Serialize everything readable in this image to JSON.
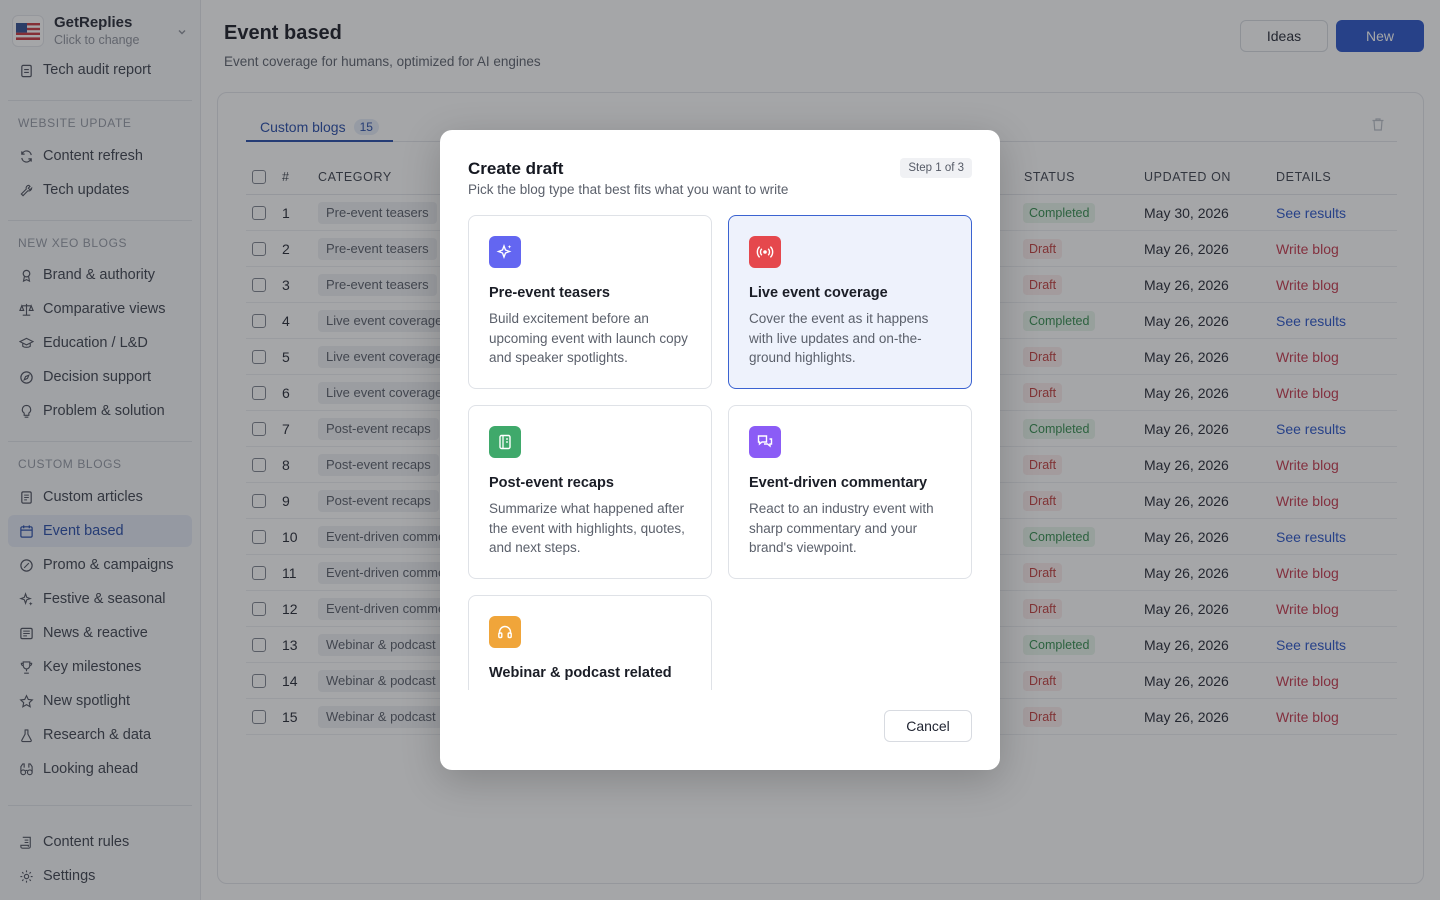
{
  "workspace": {
    "name": "GetReplies",
    "subtitle": "Click to change"
  },
  "sidebar": {
    "top_item": "Tech audit report",
    "sections": [
      {
        "label": "WEBSITE UPDATE",
        "items": [
          "Content refresh",
          "Tech updates"
        ]
      },
      {
        "label": "NEW XEO BLOGS",
        "items": [
          "Brand & authority",
          "Comparative views",
          "Education / L&D",
          "Decision support",
          "Problem & solution"
        ]
      },
      {
        "label": "CUSTOM BLOGS",
        "items": [
          "Custom articles",
          "Event based",
          "Promo & campaigns",
          "Festive & seasonal",
          "News & reactive",
          "Key milestones",
          "New spotlight",
          "Research & data",
          "Looking ahead"
        ]
      }
    ],
    "bottom_items": [
      "Content rules",
      "Settings"
    ],
    "active_item": "Event based"
  },
  "header": {
    "title": "Event based",
    "subtitle": "Event coverage for humans, optimized for AI engines",
    "ideas_label": "Ideas",
    "new_label": "New"
  },
  "tabs": [
    {
      "label": "Custom blogs",
      "count": "15"
    }
  ],
  "table": {
    "columns": {
      "num": "#",
      "category": "CATEGORY",
      "status": "STATUS",
      "updated": "UPDATED ON",
      "details": "DETAILS"
    },
    "rows": [
      {
        "num": "1",
        "category": "Pre-event teasers",
        "status": "Completed",
        "updated": "May 30, 2026",
        "details": "See results"
      },
      {
        "num": "2",
        "category": "Pre-event teasers",
        "status": "Draft",
        "updated": "May 26, 2026",
        "details": "Write blog"
      },
      {
        "num": "3",
        "category": "Pre-event teasers",
        "status": "Draft",
        "updated": "May 26, 2026",
        "details": "Write blog"
      },
      {
        "num": "4",
        "category": "Live event coverage",
        "status": "Completed",
        "updated": "May 26, 2026",
        "details": "See results"
      },
      {
        "num": "5",
        "category": "Live event coverage",
        "status": "Draft",
        "updated": "May 26, 2026",
        "details": "Write blog"
      },
      {
        "num": "6",
        "category": "Live event coverage",
        "status": "Draft",
        "updated": "May 26, 2026",
        "details": "Write blog"
      },
      {
        "num": "7",
        "category": "Post-event recaps",
        "status": "Completed",
        "updated": "May 26, 2026",
        "details": "See results"
      },
      {
        "num": "8",
        "category": "Post-event recaps",
        "status": "Draft",
        "updated": "May 26, 2026",
        "details": "Write blog"
      },
      {
        "num": "9",
        "category": "Post-event recaps",
        "status": "Draft",
        "updated": "May 26, 2026",
        "details": "Write blog"
      },
      {
        "num": "10",
        "category": "Event-driven commentary",
        "status": "Completed",
        "updated": "May 26, 2026",
        "details": "See results"
      },
      {
        "num": "11",
        "category": "Event-driven commentary",
        "status": "Draft",
        "updated": "May 26, 2026",
        "details": "Write blog"
      },
      {
        "num": "12",
        "category": "Event-driven commentary",
        "status": "Draft",
        "updated": "May 26, 2026",
        "details": "Write blog"
      },
      {
        "num": "13",
        "category": "Webinar & podcast related",
        "status": "Completed",
        "updated": "May 26, 2026",
        "details": "See results"
      },
      {
        "num": "14",
        "category": "Webinar & podcast related",
        "status": "Draft",
        "updated": "May 26, 2026",
        "details": "Write blog"
      },
      {
        "num": "15",
        "category": "Webinar & podcast related",
        "status": "Draft",
        "updated": "May 26, 2026",
        "details": "Write blog"
      }
    ]
  },
  "modal": {
    "title": "Create draft",
    "subtitle": "Pick the blog type that best fits what you want to write",
    "step": "Step 1 of 3",
    "cancel_label": "Cancel",
    "selected_option": "Live event coverage",
    "options": [
      {
        "title": "Pre-event teasers",
        "desc": "Build excitement before an upcoming event with launch copy and speaker spotlights.",
        "icon": "sparkles-icon",
        "color": "#6366f1"
      },
      {
        "title": "Live event coverage",
        "desc": "Cover the event as it happens with live updates and on-the-ground highlights.",
        "icon": "broadcast-icon",
        "color": "#e5484d"
      },
      {
        "title": "Post-event recaps",
        "desc": "Summarize what happened after the event with highlights, quotes, and next steps.",
        "icon": "notebook-icon",
        "color": "#3fa96b"
      },
      {
        "title": "Event-driven commentary",
        "desc": "React to an industry event with sharp commentary and your brand's viewpoint.",
        "icon": "chat-bubbles-icon",
        "color": "#8b5cf6"
      },
      {
        "title": "Webinar & podcast related",
        "desc": "",
        "icon": "headphones-icon",
        "color": "#f0a53a"
      }
    ]
  },
  "colors": {
    "accent": "#2652c9",
    "completed": "#2f8a4a",
    "draft": "#c03a3a"
  }
}
